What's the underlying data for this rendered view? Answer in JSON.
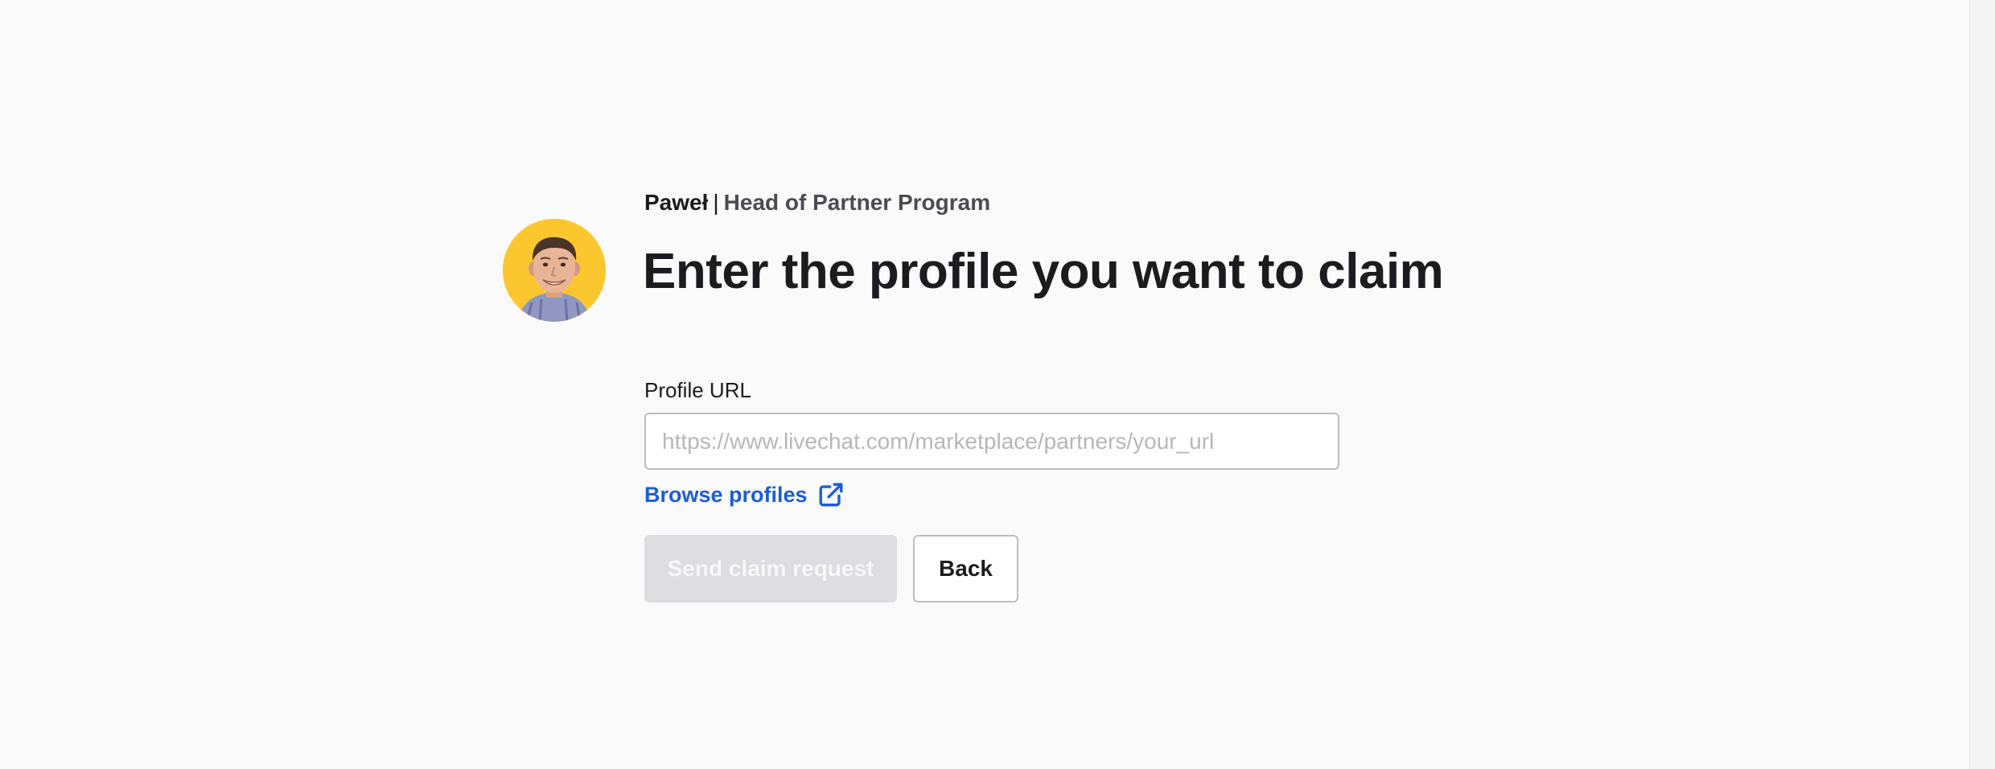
{
  "author": {
    "name": "Paweł",
    "separator": "|",
    "role": "Head of Partner Program",
    "avatar_icon": "person-avatar-icon",
    "avatar_bg": "#fcc62f"
  },
  "page_title": "Enter the profile you want to claim",
  "form": {
    "profile_url_label": "Profile URL",
    "profile_url_value": "",
    "profile_url_placeholder": "https://www.livechat.com/marketplace/partners/your_url",
    "browse_profiles_label": "Browse profiles",
    "browse_icon": "external-link-icon",
    "send_button_label": "Send claim request",
    "send_button_disabled": true,
    "back_button_label": "Back"
  },
  "colors": {
    "accent_link": "#1a5dd6",
    "background": "#fafafa",
    "disabled_button": "#dddde0"
  }
}
